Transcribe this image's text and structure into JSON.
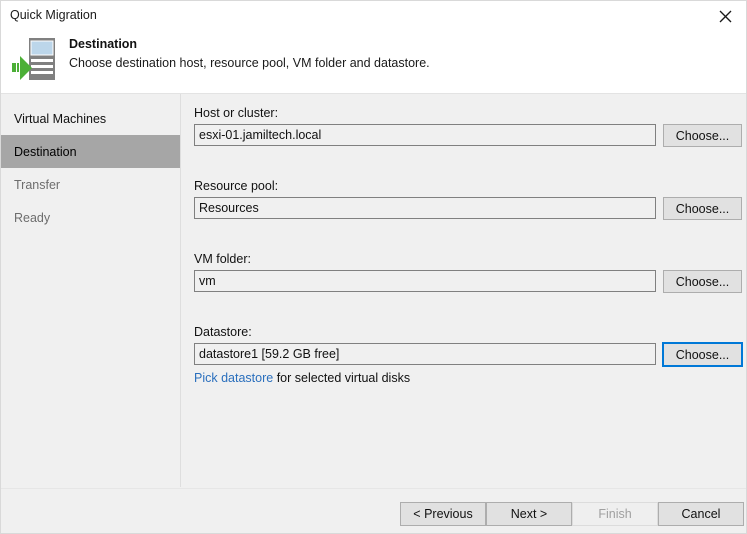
{
  "window": {
    "title": "Quick Migration",
    "close_icon": "close-icon"
  },
  "header": {
    "icon": "destination-host-migrate-icon",
    "title": "Destination",
    "subtitle": "Choose destination host, resource pool, VM folder and datastore."
  },
  "sidebar": {
    "items": [
      {
        "label": "Virtual Machines",
        "state": "normal"
      },
      {
        "label": "Destination",
        "state": "selected"
      },
      {
        "label": "Transfer",
        "state": "dim"
      },
      {
        "label": "Ready",
        "state": "dim"
      }
    ]
  },
  "main": {
    "fields": [
      {
        "label": "Host or cluster:",
        "value": "esxi-01.jamiltech.local",
        "button_label": "Choose...",
        "button_focused": false
      },
      {
        "label": "Resource pool:",
        "value": "Resources",
        "button_label": "Choose...",
        "button_focused": false
      },
      {
        "label": "VM folder:",
        "value": "vm",
        "button_label": "Choose...",
        "button_focused": false
      },
      {
        "label": "Datastore:",
        "value": "datastore1 [59.2 GB free]",
        "button_label": "Choose...",
        "button_focused": true
      }
    ],
    "pick_link": "Pick datastore",
    "pick_suffix": " for selected virtual disks"
  },
  "footer": {
    "buttons": [
      {
        "label": "< Previous",
        "disabled": false
      },
      {
        "label": "Next >",
        "disabled": false
      },
      {
        "label": "Finish",
        "disabled": true
      },
      {
        "label": "Cancel",
        "disabled": false
      }
    ]
  },
  "colors": {
    "accent_focus": "#0078d7",
    "link": "#2a6fbd",
    "selected_nav": "#a6a6a6",
    "surface": "#f0f0f0",
    "icon_green": "#4caf37",
    "icon_gray": "#808080",
    "icon_screen_blue": "#bcd6ea"
  }
}
